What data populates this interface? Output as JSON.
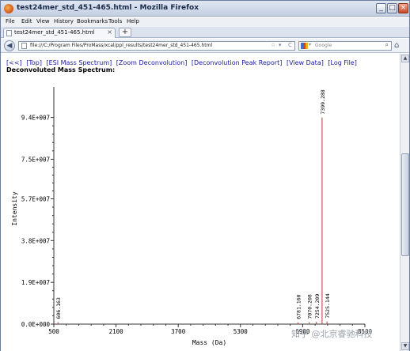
{
  "window": {
    "title": "test24mer_std_451-465.html - Mozilla Firefox",
    "minimize_glyph": "_",
    "maximize_glyph": "□",
    "close_glyph": "×"
  },
  "menu": [
    "File",
    "Edit",
    "View",
    "History",
    "Bookmarks",
    "Tools",
    "Help"
  ],
  "tab": {
    "label": "test24mer_std_451-465.html",
    "close": "×",
    "new_tab": "+"
  },
  "nav": {
    "back": "◀",
    "url": "file:///C:/Program Files/ProMass/xcal/ppl_results/test24mer_std_451-465.html",
    "star": "☆",
    "dropdown": "▾",
    "reload": "C",
    "search_placeholder": "Google",
    "search_dropdown": "▾",
    "search_glyph": "⌕",
    "home": "⌂"
  },
  "page": {
    "links": [
      "[<<]",
      "[Top]",
      "[ESI Mass Spectrum]",
      "[Zoom Deconvolution]",
      "[Deconvolution Peak Report]",
      "[View Data]",
      "[Log File]"
    ],
    "subtitle": "Deconvoluted Mass Spectrum:"
  },
  "chart_data": {
    "type": "bar",
    "title": "",
    "xlabel": "Mass (Da)",
    "ylabel": "Intensity",
    "xlim": [
      500,
      8500
    ],
    "ylim": [
      0,
      105000000
    ],
    "x_ticks": [
      500,
      2100,
      3700,
      5300,
      6900,
      8500
    ],
    "x_tick_labels": [
      "500",
      "2100",
      "3700",
      "5300",
      "6900",
      "8500"
    ],
    "y_ticks": [
      0,
      19000000,
      38000000,
      57000000,
      75000000,
      94000000
    ],
    "y_tick_labels": [
      "0.0E+000",
      "1.9E+007",
      "3.8E+007",
      "5.7E+007",
      "7.5E+007",
      "9.4E+007"
    ],
    "peaks": [
      {
        "x": 606.163,
        "y": 900000,
        "label": "606.163"
      },
      {
        "x": 6781.16,
        "y": 800000,
        "label": "6781.160"
      },
      {
        "x": 7070.208,
        "y": 900000,
        "label": "7070.208"
      },
      {
        "x": 7254.209,
        "y": 1100000,
        "label": "7254.209"
      },
      {
        "x": 7399.288,
        "y": 94000000,
        "label": "7399.288"
      },
      {
        "x": 7525.144,
        "y": 1200000,
        "label": "7525.144"
      }
    ],
    "color": "#c0392b",
    "grid": false
  },
  "watermark": "知乎 @北京睿驰科技"
}
